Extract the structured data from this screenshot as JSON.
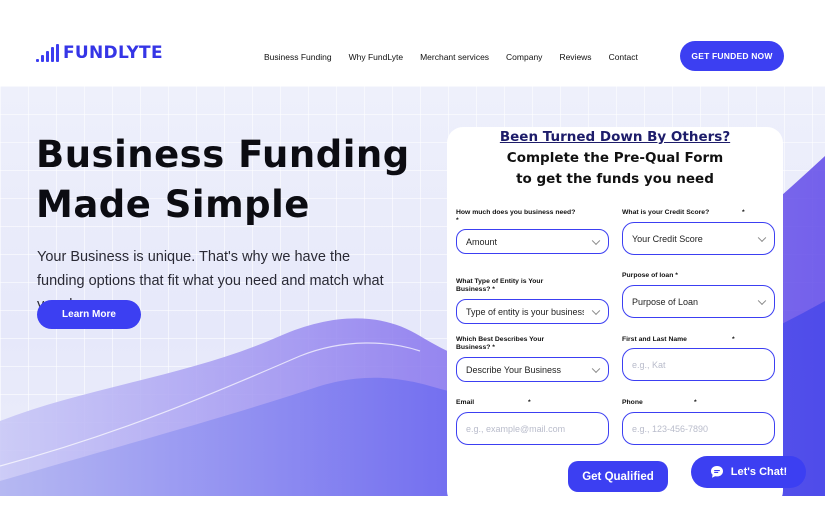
{
  "brand": {
    "name": "FUNDLYTE",
    "color": "#3c3ff2"
  },
  "nav": {
    "items": [
      "Business Funding",
      "Why FundLyte",
      "Merchant services",
      "Company",
      "Reviews",
      "Contact"
    ]
  },
  "header": {
    "cta_label": "GET FUNDED NOW"
  },
  "hero": {
    "title_line1": "Business Funding",
    "title_line2": "Made Simple",
    "subtitle": "Your Business is unique. That's why we have the funding options that fit what you need and match what you do.",
    "learn_more_label": "Learn More"
  },
  "form": {
    "heading_line1": "Been Turned Down By Others?",
    "heading_line2": "Complete the Pre-Qual Form",
    "heading_line3": "to get the funds you need",
    "amount": {
      "label": "How much does you business need?",
      "value": "Amount"
    },
    "credit": {
      "label": "What is your Credit Score?",
      "value": "Your Credit Score"
    },
    "entity": {
      "label": "What Type of Entity is Your Business?",
      "value": "Type of entity is your business"
    },
    "purpose": {
      "label": "Purpose of loan",
      "value": "Purpose of Loan"
    },
    "describe": {
      "label": "Which Best Describes Your Business?",
      "value": "Describe Your Business"
    },
    "name": {
      "label": "First and Last Name",
      "placeholder": "e.g., Kat"
    },
    "email": {
      "label": "Email",
      "placeholder": "e.g., example@mail.com"
    },
    "phone": {
      "label": "Phone",
      "placeholder": "e.g., 123-456-7890"
    },
    "required_mark": "*",
    "submit_label": "Get Qualified"
  },
  "chat": {
    "label": "Let's Chat!",
    "icon": "chat-bubble-icon"
  }
}
